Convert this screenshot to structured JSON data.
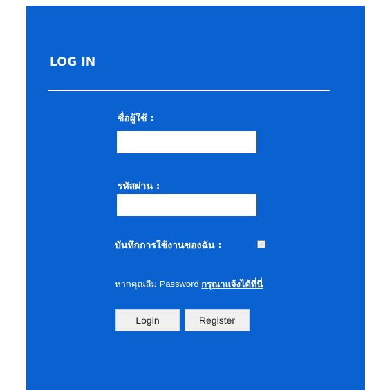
{
  "login": {
    "title": "LOG IN",
    "username_label": "ชื่อผู้ใช้ :",
    "username_value": "",
    "password_label": "รหัสผ่าน :",
    "password_value": "",
    "remember_label": "บันทึกการใช้งานของฉัน :",
    "remember_checked": false,
    "forgot_prefix": "หากคุณลืม Password",
    "forgot_link": "กรุณาแจ้งได้ที่นี่",
    "login_button": "Login",
    "register_button": "Register"
  },
  "colors": {
    "panel_bg": "#0a62d0",
    "text": "#ffffff"
  }
}
